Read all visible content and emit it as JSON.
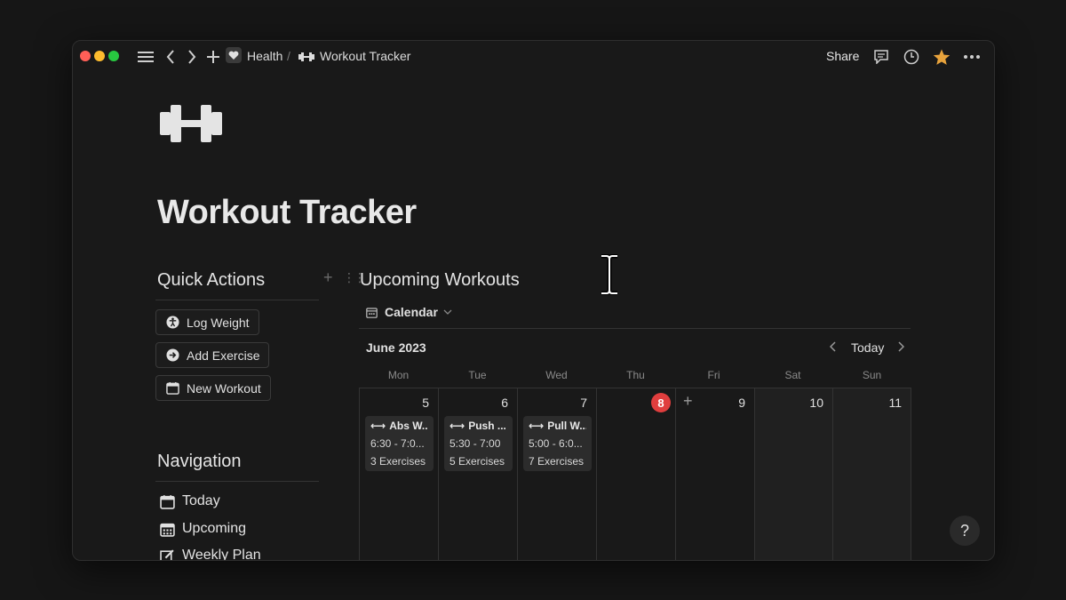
{
  "breadcrumb": {
    "parent": "Health",
    "separator": "/",
    "current": "Workout Tracker"
  },
  "topbar": {
    "share_label": "Share"
  },
  "page": {
    "title": "Workout Tracker"
  },
  "quick_actions": {
    "heading": "Quick Actions",
    "buttons": [
      {
        "label": "Log Weight",
        "icon": "accessibility-icon"
      },
      {
        "label": "Add Exercise",
        "icon": "arrow-circle-icon"
      },
      {
        "label": "New Workout",
        "icon": "calendar-icon"
      }
    ]
  },
  "navigation": {
    "heading": "Navigation",
    "items": [
      {
        "label": "Today",
        "icon": "calendar-icon"
      },
      {
        "label": "Upcoming",
        "icon": "calendar-grid-icon"
      },
      {
        "label": "Weekly Plan",
        "icon": "edit-icon"
      }
    ]
  },
  "upcoming": {
    "heading": "Upcoming Workouts",
    "view_label": "Calendar",
    "month_label": "June 2023",
    "today_label": "Today",
    "weekdays": [
      "Mon",
      "Tue",
      "Wed",
      "Thu",
      "Fri",
      "Sat",
      "Sun"
    ],
    "days": [
      "5",
      "6",
      "7",
      "8",
      "9",
      "10",
      "11"
    ],
    "today_index": 3,
    "events": [
      {
        "title": "Abs W...",
        "time": "6:30 - 7:0...",
        "exercises": "3 Exercises"
      },
      {
        "title": "Push ...",
        "time": "5:30 - 7:00",
        "exercises": "5 Exercises"
      },
      {
        "title": "Pull W...",
        "time": "5:00 - 6:0...",
        "exercises": "7 Exercises"
      }
    ]
  },
  "help_label": "?",
  "colors": {
    "accent_star": "#e8a33c",
    "today_red": "#e03e3e"
  }
}
